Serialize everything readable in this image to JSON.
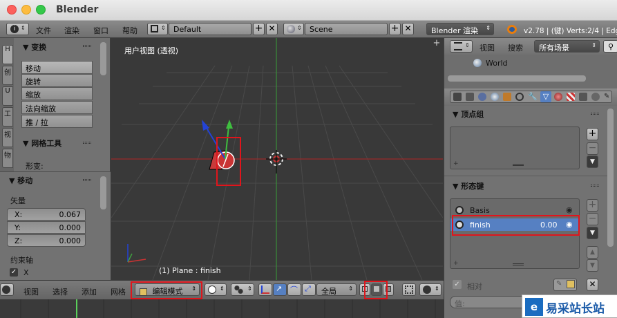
{
  "window": {
    "title": "Blender"
  },
  "topbar": {
    "menus": [
      "文件",
      "渲染",
      "窗口",
      "帮助"
    ],
    "layout": "Default",
    "scene": "Scene",
    "engine": "Blender 渲染",
    "version": "v2.78 | (键) Verts:2/4 | Edg"
  },
  "left_panel": {
    "tabs": [
      "H",
      "创",
      "U",
      "工",
      "视",
      "物"
    ],
    "transform_header": "▼ 变换",
    "transform_buttons": [
      "移动",
      "旋转",
      "缩放",
      "法向缩放",
      "推 / 拉"
    ],
    "mesh_tools_header": "▼ 网格工具",
    "deform_label": "形变:",
    "move_header": "▼ 移动",
    "vector_label": "矢量",
    "x": {
      "label": "X:",
      "value": "0.067"
    },
    "y": {
      "label": "Y:",
      "value": "0.000"
    },
    "z": {
      "label": "Z:",
      "value": "0.000"
    },
    "constraint_label": "约束轴",
    "x_axis_label": "X"
  },
  "viewport": {
    "label": "用户视图 (透视)",
    "status": "(1) Plane : finish"
  },
  "bottom": {
    "menus": [
      "视图",
      "选择",
      "添加",
      "网格"
    ],
    "mode": "编辑模式",
    "transform_orientation": "全局"
  },
  "right_panel": {
    "menus": [
      "视图",
      "搜索"
    ],
    "filter": "所有场景",
    "outliner_item": "World",
    "vertex_groups_header": "▼ 顶点组",
    "shape_keys_header": "▼ 形态键",
    "shape_keys": [
      {
        "name": "Basis",
        "value": ""
      },
      {
        "name": "finish",
        "value": "0.00"
      }
    ],
    "relative_label": "相对",
    "value_label": "值:"
  },
  "watermark": "易采站长站",
  "colors": {
    "selected_row": "#5680c2",
    "red_highlight": "#e0151c",
    "x_axis": "#c32626",
    "y_axis": "#3fa03f",
    "z_axis": "#2343d6"
  }
}
